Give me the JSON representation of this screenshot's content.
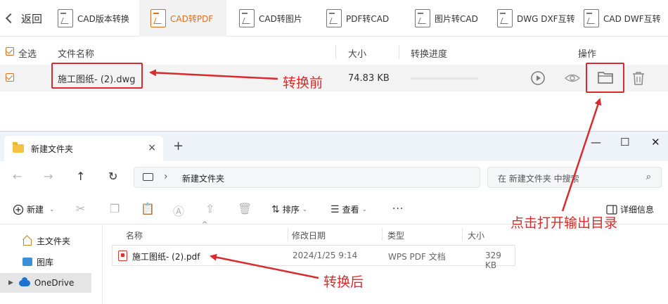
{
  "converter": {
    "back_label": "返回",
    "tabs": [
      {
        "label": "CAD版本转换"
      },
      {
        "label": "CAD转PDF"
      },
      {
        "label": "CAD转图片"
      },
      {
        "label": "PDF转CAD"
      },
      {
        "label": "图片转CAD"
      },
      {
        "label": "DWG DXF互转"
      },
      {
        "label": "CAD DWF互转"
      }
    ],
    "active_tab": "CAD转PDF",
    "accent_color": "#e0701e",
    "columns": {
      "select_all": "全选",
      "file_name": "文件名称",
      "size": "大小",
      "progress": "转换进度",
      "actions": "操作"
    },
    "file": {
      "name": "施工图纸- (2).dwg",
      "size": "74.83 KB",
      "progress": 0
    },
    "action_icons": [
      "play-icon",
      "eye-icon",
      "folder-icon",
      "trash-icon"
    ]
  },
  "annotations": {
    "before": "转换前",
    "after": "转换后",
    "open_output": "点击打开输出目录",
    "color": "#d92b2b"
  },
  "explorer": {
    "tab_title": "新建文件夹",
    "tab_close": "×",
    "new_tab": "+",
    "window_controls": [
      "—",
      "☐",
      "✕"
    ],
    "nav_icons": [
      "←",
      "→",
      "↑",
      "↻"
    ],
    "address": {
      "separator": "›",
      "crumb": "新建文件夹"
    },
    "search_placeholder": "在 新建文件夹 中搜索",
    "search_icon": "⌕",
    "commands": {
      "new": "新建",
      "sort": "排序",
      "view": "查看",
      "more": "···",
      "details": "详细信息"
    },
    "sidebar": [
      {
        "label": "主文件夹"
      },
      {
        "label": "图库"
      },
      {
        "label": "OneDrive"
      }
    ],
    "columns": {
      "name": "名称",
      "modified": "修改日期",
      "type": "类型",
      "size": "大小"
    },
    "files": [
      {
        "name": "施工图纸- (2).pdf",
        "modified": "2024/1/25 9:14",
        "type": "WPS PDF 文档",
        "size": "329 KB"
      }
    ]
  }
}
